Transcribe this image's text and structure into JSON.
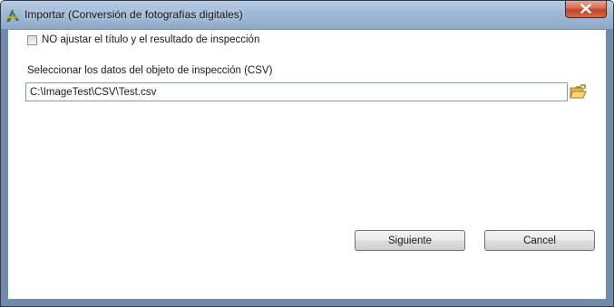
{
  "window": {
    "title": "Importar (Conversión de fotografías digitales)",
    "app_icon": "caliper-icon",
    "close_icon": "close-x-icon"
  },
  "options": {
    "no_adjust_checkbox": {
      "label": "NO ajustar el título y el resultado de inspección",
      "checked": false
    }
  },
  "csv": {
    "label": "Seleccionar los datos del objeto de inspección (CSV)",
    "path_value": "C:\\ImageTest\\CSV\\Test.csv",
    "browse_icon": "folder-open-icon"
  },
  "buttons": {
    "next_label": "Siguiente",
    "cancel_label": "Cancel"
  },
  "colors": {
    "titlebar": "#9fb8d4",
    "close_button": "#c0432a",
    "input_border": "#7f9db9"
  }
}
